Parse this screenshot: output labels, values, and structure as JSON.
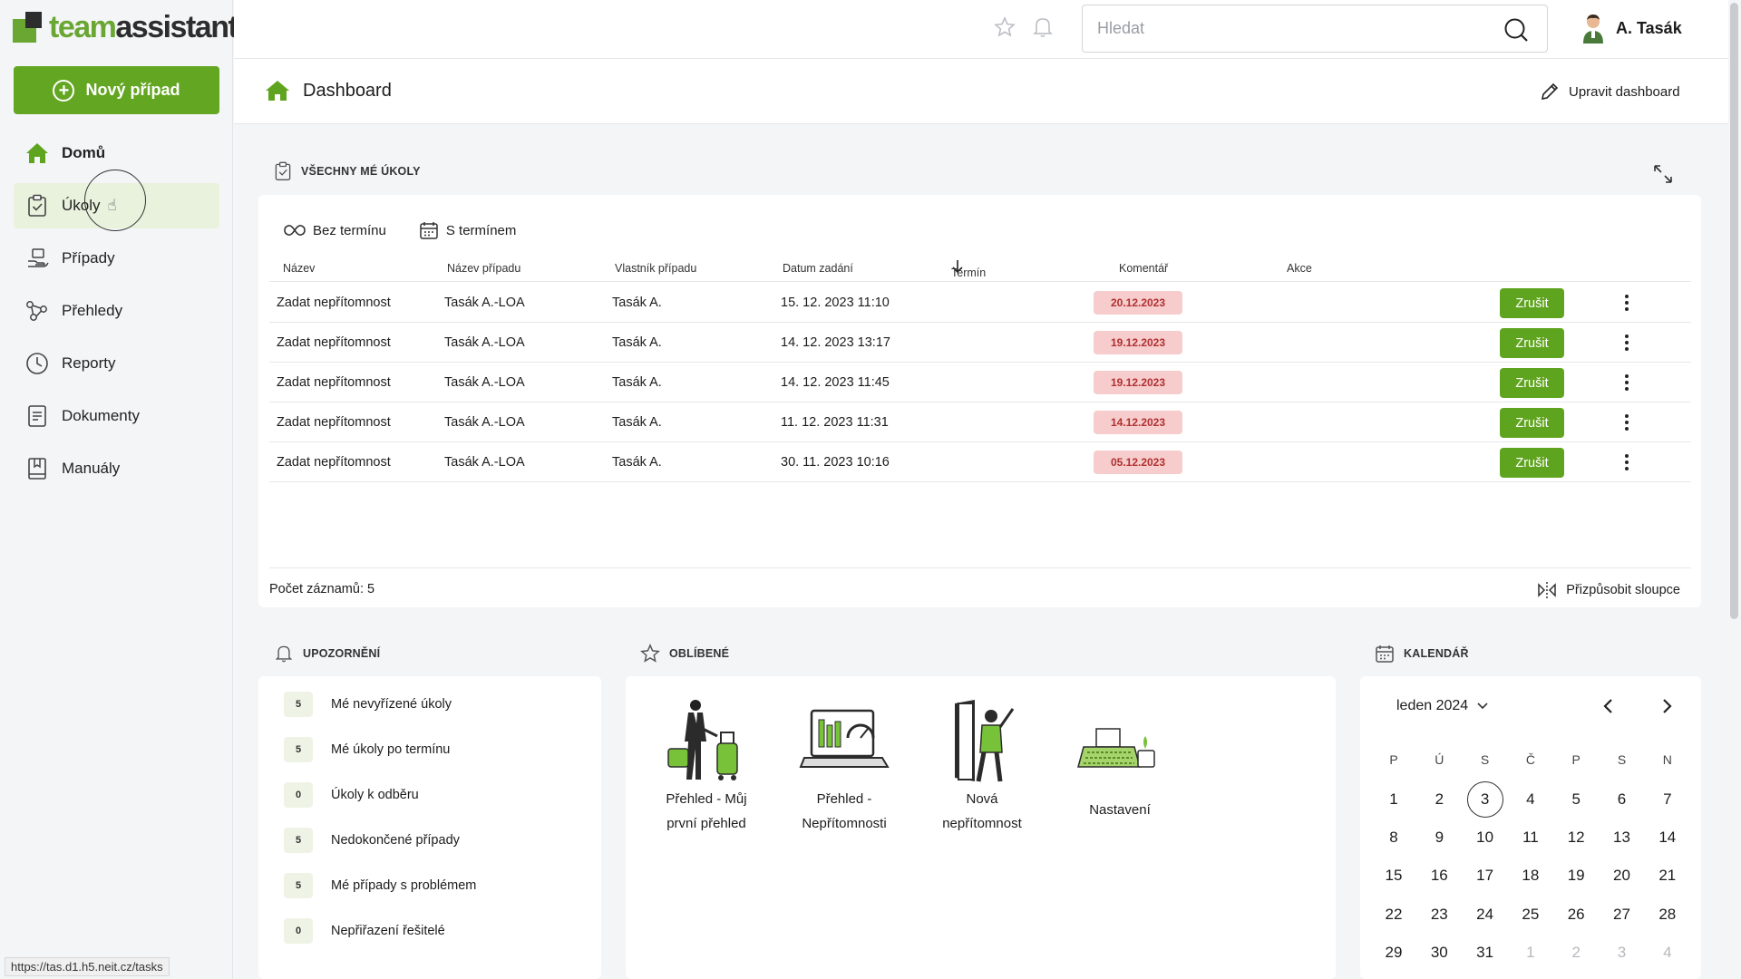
{
  "brand": {
    "logo_team": "team",
    "logo_rest": "assistant",
    "accent": "#63a621"
  },
  "sidebar": {
    "new_case_label": "Nový případ",
    "items": [
      {
        "label": "Domů"
      },
      {
        "label": "Úkoly"
      },
      {
        "label": "Případy"
      },
      {
        "label": "Přehledy"
      },
      {
        "label": "Reporty"
      },
      {
        "label": "Dokumenty"
      },
      {
        "label": "Manuály"
      }
    ],
    "status_url": "https://tas.d1.h5.neit.cz/tasks"
  },
  "topbar": {
    "search_placeholder": "Hledat",
    "user_name": "A. Tasák"
  },
  "page": {
    "title": "Dashboard",
    "edit_label": "Upravit dashboard"
  },
  "tasks": {
    "section_title": "VŠECHNY MÉ ÚKOLY",
    "tabs": [
      "Bez termínu",
      "S termínem"
    ],
    "columns": [
      "Název",
      "Název případu",
      "Vlastník případu",
      "Datum zadání",
      "Termín",
      "Komentář",
      "Akce"
    ],
    "rows": [
      {
        "name": "Zadat nepřítomnost",
        "case": "Tasák A.-LOA",
        "owner": "Tasák A.",
        "assigned": "15. 12. 2023 11:10",
        "deadline": "20.12.2023",
        "action": "Zrušit"
      },
      {
        "name": "Zadat nepřítomnost",
        "case": "Tasák A.-LOA",
        "owner": "Tasák A.",
        "assigned": "14. 12. 2023 13:17",
        "deadline": "19.12.2023",
        "action": "Zrušit"
      },
      {
        "name": "Zadat nepřítomnost",
        "case": "Tasák A.-LOA",
        "owner": "Tasák A.",
        "assigned": "14. 12. 2023 11:45",
        "deadline": "19.12.2023",
        "action": "Zrušit"
      },
      {
        "name": "Zadat nepřítomnost",
        "case": "Tasák A.-LOA",
        "owner": "Tasák A.",
        "assigned": "11. 12. 2023 11:31",
        "deadline": "14.12.2023",
        "action": "Zrušit"
      },
      {
        "name": "Zadat nepřítomnost",
        "case": "Tasák A.-LOA",
        "owner": "Tasák A.",
        "assigned": "30. 11. 2023 10:16",
        "deadline": "05.12.2023",
        "action": "Zrušit"
      }
    ],
    "record_count": "Počet záznamů: 5",
    "customize_label": "Přizpůsobit sloupce"
  },
  "alerts": {
    "section_title": "UPOZORNĚNÍ",
    "items": [
      {
        "count": "5",
        "label": "Mé nevyřízené úkoly"
      },
      {
        "count": "5",
        "label": "Mé úkoly po termínu"
      },
      {
        "count": "0",
        "label": "Úkoly k odběru"
      },
      {
        "count": "5",
        "label": "Nedokončené případy"
      },
      {
        "count": "5",
        "label": "Mé případy s problémem"
      },
      {
        "count": "0",
        "label": "Nepřiřazení řešitelé"
      }
    ]
  },
  "favorites": {
    "section_title": "OBLÍBENÉ",
    "items": [
      {
        "line1": "Přehled - Můj",
        "line2": "první přehled"
      },
      {
        "line1": "Přehled -",
        "line2": "Nepřítomnosti"
      },
      {
        "line1": "Nová",
        "line2": "nepřítomnost"
      },
      {
        "line1": "Nastavení",
        "line2": ""
      }
    ]
  },
  "calendar": {
    "section_title": "KALENDÁŘ",
    "month": "leden 2024",
    "weekdays": [
      "P",
      "Ú",
      "S",
      "Č",
      "P",
      "S",
      "N"
    ],
    "days": [
      "1",
      "2",
      "3",
      "4",
      "5",
      "6",
      "7",
      "8",
      "9",
      "10",
      "11",
      "12",
      "13",
      "14",
      "15",
      "16",
      "17",
      "18",
      "19",
      "20",
      "21",
      "22",
      "23",
      "24",
      "25",
      "26",
      "27",
      "28",
      "29",
      "30",
      "31",
      "1",
      "2",
      "3",
      "4"
    ],
    "today": "3"
  }
}
